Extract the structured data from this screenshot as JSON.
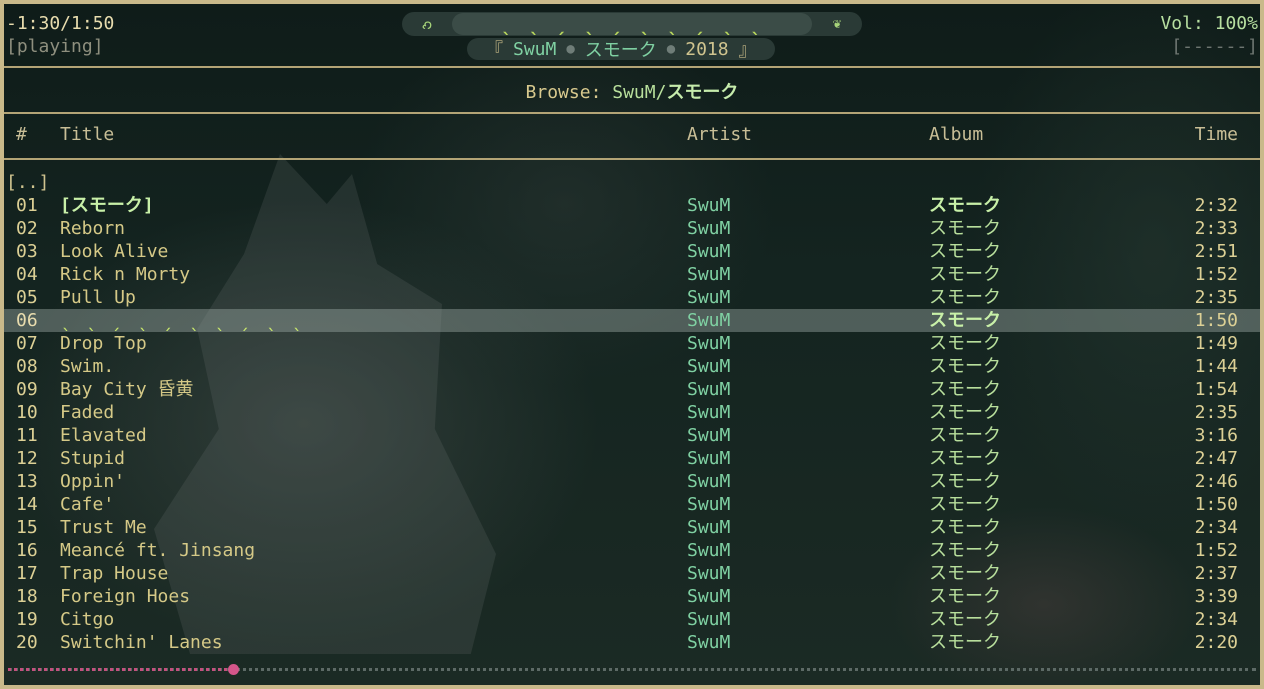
{
  "header": {
    "elapsed": "-1:30/1:50",
    "state": "[playing]",
    "volume": "Vol: 100%",
    "volume_bar": "[------]"
  },
  "title_bar": {
    "left_icon": "grass-icon",
    "track_ticks": "ˎ ˎ ˏ ˎ ˏ ˎ ˎ ˏ ˎ ˎ",
    "right_icon": "sprout-icon"
  },
  "now_playing": {
    "open_bracket": "『",
    "artist": "SwuM",
    "album": "スモーク",
    "year": "2018",
    "close_bracket": "』",
    "separator": "●"
  },
  "browse": {
    "label": "Browse: ",
    "path": "SwuM/",
    "path_bold": "スモーク"
  },
  "columns": {
    "num": "#",
    "title": "Title",
    "artist": "Artist",
    "album": "Album",
    "time": "Time"
  },
  "parent_dir": "[..]",
  "tracks": [
    {
      "num": "01",
      "title": "[スモーク]",
      "artist": "SwuM",
      "album": "スモーク",
      "time": "2:32"
    },
    {
      "num": "02",
      "title": "Reborn",
      "artist": "SwuM",
      "album": "スモーク",
      "time": "2:33"
    },
    {
      "num": "03",
      "title": "Look Alive",
      "artist": "SwuM",
      "album": "スモーク",
      "time": "2:51"
    },
    {
      "num": "04",
      "title": "Rick n Morty",
      "artist": "SwuM",
      "album": "スモーク",
      "time": "1:52"
    },
    {
      "num": "05",
      "title": "Pull Up",
      "artist": "SwuM",
      "album": "スモーク",
      "time": "2:35"
    },
    {
      "num": "06",
      "title": "ˎ ˎ ˏ ˎ ˏ ˎ ˎ ˏ ˎ ˎ",
      "artist": "SwuM",
      "album": "スモーク",
      "time": "1:50"
    },
    {
      "num": "07",
      "title": "Drop Top",
      "artist": "SwuM",
      "album": "スモーク",
      "time": "1:49"
    },
    {
      "num": "08",
      "title": "Swim.",
      "artist": "SwuM",
      "album": "スモーク",
      "time": "1:44"
    },
    {
      "num": "09",
      "title": "Bay City 昏黄",
      "artist": "SwuM",
      "album": "スモーク",
      "time": "1:54"
    },
    {
      "num": "10",
      "title": "Faded",
      "artist": "SwuM",
      "album": "スモーク",
      "time": "2:35"
    },
    {
      "num": "11",
      "title": "Elavated",
      "artist": "SwuM",
      "album": "スモーク",
      "time": "3:16"
    },
    {
      "num": "12",
      "title": "Stupid",
      "artist": "SwuM",
      "album": "スモーク",
      "time": "2:47"
    },
    {
      "num": "13",
      "title": "Oppin'",
      "artist": "SwuM",
      "album": "スモーク",
      "time": "2:46"
    },
    {
      "num": "14",
      "title": "Cafe'",
      "artist": "SwuM",
      "album": "スモーク",
      "time": "1:50"
    },
    {
      "num": "15",
      "title": "Trust Me",
      "artist": "SwuM",
      "album": "スモーク",
      "time": "2:34"
    },
    {
      "num": "16",
      "title": "Meancé ft. Jinsang",
      "artist": "SwuM",
      "album": "スモーク",
      "time": "1:52"
    },
    {
      "num": "17",
      "title": "Trap House",
      "artist": "SwuM",
      "album": "スモーク",
      "time": "2:37"
    },
    {
      "num": "18",
      "title": "Foreign Hoes",
      "artist": "SwuM",
      "album": "スモーク",
      "time": "3:39"
    },
    {
      "num": "19",
      "title": "Citgo",
      "artist": "SwuM",
      "album": "スモーク",
      "time": "2:34"
    },
    {
      "num": "20",
      "title": "Switchin' Lanes",
      "artist": "SwuM",
      "album": "スモーク",
      "time": "2:20"
    }
  ],
  "current_index": 0,
  "selected_index": 5,
  "progress": {
    "fraction": 0.18
  },
  "colors": {
    "frame": "#c9b98a",
    "accent_green": "#b8df9c",
    "artist_teal": "#7fd0a2",
    "progress_pink": "#d4568a"
  }
}
